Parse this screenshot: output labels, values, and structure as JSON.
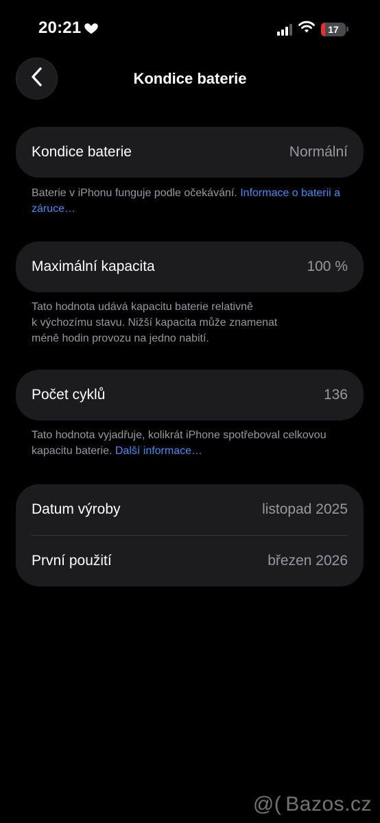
{
  "status_bar": {
    "time": "20:21",
    "battery_percent": "17",
    "battery_level": 0.17,
    "signal_bars_active": 3,
    "signal_bars_total": 4
  },
  "nav": {
    "title": "Kondice baterie",
    "back_icon": "chevron-left-icon"
  },
  "battery_health": {
    "label": "Kondice baterie",
    "value": "Normální",
    "footnote_text": "Baterie v iPhonu funguje podle očekávání. ",
    "footnote_link": "Informace o baterii a záruce…"
  },
  "max_capacity": {
    "label": "Maximální kapacita",
    "value": "100 %",
    "footnote_line1": "Tato hodnota udává kapacitu baterie relativně",
    "footnote_line2": "k výchozímu stavu. Nižší kapacita může znamenat",
    "footnote_line3": "méně hodin provozu na jedno nabití."
  },
  "cycle_count": {
    "label": "Počet cyklů",
    "value": "136",
    "footnote_text": "Tato hodnota vyjadřuje, kolikrát iPhone spotřeboval celkovou kapacitu baterie. ",
    "footnote_link": "Další informace…"
  },
  "dates": {
    "manufacture_label": "Datum výroby",
    "manufacture_value": "listopad 2025",
    "first_use_label": "První použití",
    "first_use_value": "březen 2026"
  },
  "watermark": {
    "text": "Bazos.cz",
    "prefix": "@("
  },
  "colors": {
    "background": "#000000",
    "card": "#1c1c1e",
    "secondary_text": "#98989f",
    "link": "#3e8ef7",
    "battery_low": "#e5322d"
  }
}
